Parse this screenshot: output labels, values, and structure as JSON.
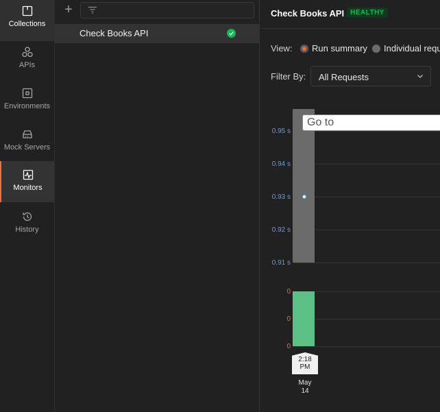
{
  "sidebar": {
    "items": [
      {
        "label": "Collections",
        "icon": "collections-icon"
      },
      {
        "label": "APIs",
        "icon": "apis-icon"
      },
      {
        "label": "Environments",
        "icon": "environments-icon"
      },
      {
        "label": "Mock Servers",
        "icon": "mock-servers-icon"
      },
      {
        "label": "Monitors",
        "icon": "monitors-icon"
      },
      {
        "label": "History",
        "icon": "history-icon"
      }
    ],
    "selected": "Monitors"
  },
  "monitor_list": {
    "items": [
      {
        "name": "Check Books API",
        "status": "healthy"
      }
    ]
  },
  "monitor": {
    "title": "Check Books API",
    "status_badge": "HEALTHY",
    "view_label": "View:",
    "view_options": [
      "Run summary",
      "Individual requ"
    ],
    "view_selected": "Run summary",
    "filter_label": "Filter By:",
    "filter_value": "All Requests",
    "goto_placeholder": "Go to"
  },
  "colors": {
    "accent": "#f26b3a",
    "healthy": "#0cbb52",
    "response_bar": "#6b6b6b",
    "success_bar": "#5cbf85",
    "axis_blue": "#5b9ef2"
  },
  "chart_data": {
    "type": "bar",
    "top_panel": {
      "ylabel": "",
      "ticks": [
        "0.95 s",
        "0.94 s",
        "0.93 s",
        "0.92 s",
        "0.91 s"
      ],
      "ylim": [
        0.91,
        0.95
      ],
      "series": [
        {
          "values": [
            0.93
          ]
        }
      ]
    },
    "bottom_panel": {
      "ticks": [
        "0",
        "0",
        "0"
      ],
      "series": [
        {
          "values": [
            1
          ]
        }
      ]
    },
    "categories": [
      {
        "time_line1": "2:18",
        "time_line2": "PM",
        "date_line1": "May",
        "date_line2": "14"
      }
    ]
  }
}
